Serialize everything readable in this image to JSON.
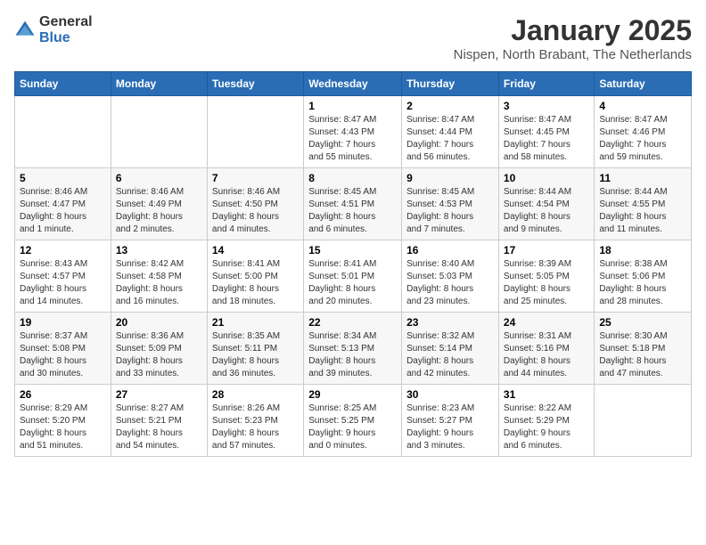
{
  "header": {
    "logo_general": "General",
    "logo_blue": "Blue",
    "main_title": "January 2025",
    "subtitle": "Nispen, North Brabant, The Netherlands"
  },
  "days_of_week": [
    "Sunday",
    "Monday",
    "Tuesday",
    "Wednesday",
    "Thursday",
    "Friday",
    "Saturday"
  ],
  "weeks": [
    {
      "days": [
        {
          "number": "",
          "info": ""
        },
        {
          "number": "",
          "info": ""
        },
        {
          "number": "",
          "info": ""
        },
        {
          "number": "1",
          "info": "Sunrise: 8:47 AM\nSunset: 4:43 PM\nDaylight: 7 hours\nand 55 minutes."
        },
        {
          "number": "2",
          "info": "Sunrise: 8:47 AM\nSunset: 4:44 PM\nDaylight: 7 hours\nand 56 minutes."
        },
        {
          "number": "3",
          "info": "Sunrise: 8:47 AM\nSunset: 4:45 PM\nDaylight: 7 hours\nand 58 minutes."
        },
        {
          "number": "4",
          "info": "Sunrise: 8:47 AM\nSunset: 4:46 PM\nDaylight: 7 hours\nand 59 minutes."
        }
      ]
    },
    {
      "days": [
        {
          "number": "5",
          "info": "Sunrise: 8:46 AM\nSunset: 4:47 PM\nDaylight: 8 hours\nand 1 minute."
        },
        {
          "number": "6",
          "info": "Sunrise: 8:46 AM\nSunset: 4:49 PM\nDaylight: 8 hours\nand 2 minutes."
        },
        {
          "number": "7",
          "info": "Sunrise: 8:46 AM\nSunset: 4:50 PM\nDaylight: 8 hours\nand 4 minutes."
        },
        {
          "number": "8",
          "info": "Sunrise: 8:45 AM\nSunset: 4:51 PM\nDaylight: 8 hours\nand 6 minutes."
        },
        {
          "number": "9",
          "info": "Sunrise: 8:45 AM\nSunset: 4:53 PM\nDaylight: 8 hours\nand 7 minutes."
        },
        {
          "number": "10",
          "info": "Sunrise: 8:44 AM\nSunset: 4:54 PM\nDaylight: 8 hours\nand 9 minutes."
        },
        {
          "number": "11",
          "info": "Sunrise: 8:44 AM\nSunset: 4:55 PM\nDaylight: 8 hours\nand 11 minutes."
        }
      ]
    },
    {
      "days": [
        {
          "number": "12",
          "info": "Sunrise: 8:43 AM\nSunset: 4:57 PM\nDaylight: 8 hours\nand 14 minutes."
        },
        {
          "number": "13",
          "info": "Sunrise: 8:42 AM\nSunset: 4:58 PM\nDaylight: 8 hours\nand 16 minutes."
        },
        {
          "number": "14",
          "info": "Sunrise: 8:41 AM\nSunset: 5:00 PM\nDaylight: 8 hours\nand 18 minutes."
        },
        {
          "number": "15",
          "info": "Sunrise: 8:41 AM\nSunset: 5:01 PM\nDaylight: 8 hours\nand 20 minutes."
        },
        {
          "number": "16",
          "info": "Sunrise: 8:40 AM\nSunset: 5:03 PM\nDaylight: 8 hours\nand 23 minutes."
        },
        {
          "number": "17",
          "info": "Sunrise: 8:39 AM\nSunset: 5:05 PM\nDaylight: 8 hours\nand 25 minutes."
        },
        {
          "number": "18",
          "info": "Sunrise: 8:38 AM\nSunset: 5:06 PM\nDaylight: 8 hours\nand 28 minutes."
        }
      ]
    },
    {
      "days": [
        {
          "number": "19",
          "info": "Sunrise: 8:37 AM\nSunset: 5:08 PM\nDaylight: 8 hours\nand 30 minutes."
        },
        {
          "number": "20",
          "info": "Sunrise: 8:36 AM\nSunset: 5:09 PM\nDaylight: 8 hours\nand 33 minutes."
        },
        {
          "number": "21",
          "info": "Sunrise: 8:35 AM\nSunset: 5:11 PM\nDaylight: 8 hours\nand 36 minutes."
        },
        {
          "number": "22",
          "info": "Sunrise: 8:34 AM\nSunset: 5:13 PM\nDaylight: 8 hours\nand 39 minutes."
        },
        {
          "number": "23",
          "info": "Sunrise: 8:32 AM\nSunset: 5:14 PM\nDaylight: 8 hours\nand 42 minutes."
        },
        {
          "number": "24",
          "info": "Sunrise: 8:31 AM\nSunset: 5:16 PM\nDaylight: 8 hours\nand 44 minutes."
        },
        {
          "number": "25",
          "info": "Sunrise: 8:30 AM\nSunset: 5:18 PM\nDaylight: 8 hours\nand 47 minutes."
        }
      ]
    },
    {
      "days": [
        {
          "number": "26",
          "info": "Sunrise: 8:29 AM\nSunset: 5:20 PM\nDaylight: 8 hours\nand 51 minutes."
        },
        {
          "number": "27",
          "info": "Sunrise: 8:27 AM\nSunset: 5:21 PM\nDaylight: 8 hours\nand 54 minutes."
        },
        {
          "number": "28",
          "info": "Sunrise: 8:26 AM\nSunset: 5:23 PM\nDaylight: 8 hours\nand 57 minutes."
        },
        {
          "number": "29",
          "info": "Sunrise: 8:25 AM\nSunset: 5:25 PM\nDaylight: 9 hours\nand 0 minutes."
        },
        {
          "number": "30",
          "info": "Sunrise: 8:23 AM\nSunset: 5:27 PM\nDaylight: 9 hours\nand 3 minutes."
        },
        {
          "number": "31",
          "info": "Sunrise: 8:22 AM\nSunset: 5:29 PM\nDaylight: 9 hours\nand 6 minutes."
        },
        {
          "number": "",
          "info": ""
        }
      ]
    }
  ]
}
